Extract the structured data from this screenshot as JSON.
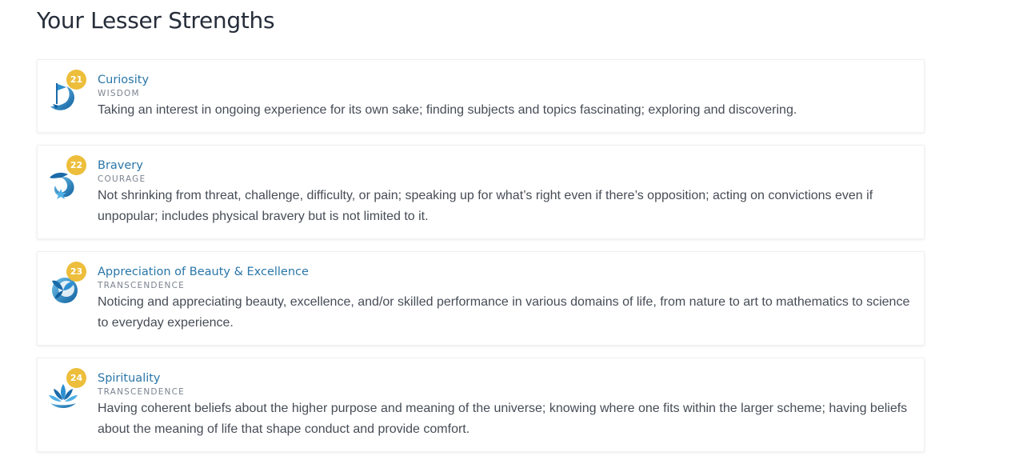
{
  "page_title": "Your Lesser Strengths",
  "accent_color": "#2a76a8",
  "badge_color": "#edbe3b",
  "strengths": [
    {
      "rank": "21",
      "name": "Curiosity",
      "virtue": "WISDOM",
      "description": "Taking an interest in ongoing experience for its own sake; finding subjects and topics fascinating; exploring and discovering.",
      "icon": "curiosity-flag-icon"
    },
    {
      "rank": "22",
      "name": "Bravery",
      "virtue": "COURAGE",
      "description": "Not shrinking from threat, challenge, difficulty, or pain; speaking up for what’s right even if there’s opposition; acting on convictions even if unpopular; includes physical bravery but is not limited to it.",
      "icon": "bravery-star-icon"
    },
    {
      "rank": "23",
      "name": "Appreciation of Beauty & Excellence",
      "virtue": "TRANSCENDENCE",
      "description": "Noticing and appreciating beauty, excellence, and/or skilled performance in various domains of life, from nature to art to mathematics to science to everyday experience.",
      "icon": "butterfly-icon"
    },
    {
      "rank": "24",
      "name": "Spirituality",
      "virtue": "TRANSCENDENCE",
      "description": "Having coherent beliefs about the higher purpose and meaning of the universe; knowing where one fits within the larger scheme; having beliefs about the meaning of life that shape conduct and provide comfort.",
      "icon": "lotus-icon"
    }
  ]
}
